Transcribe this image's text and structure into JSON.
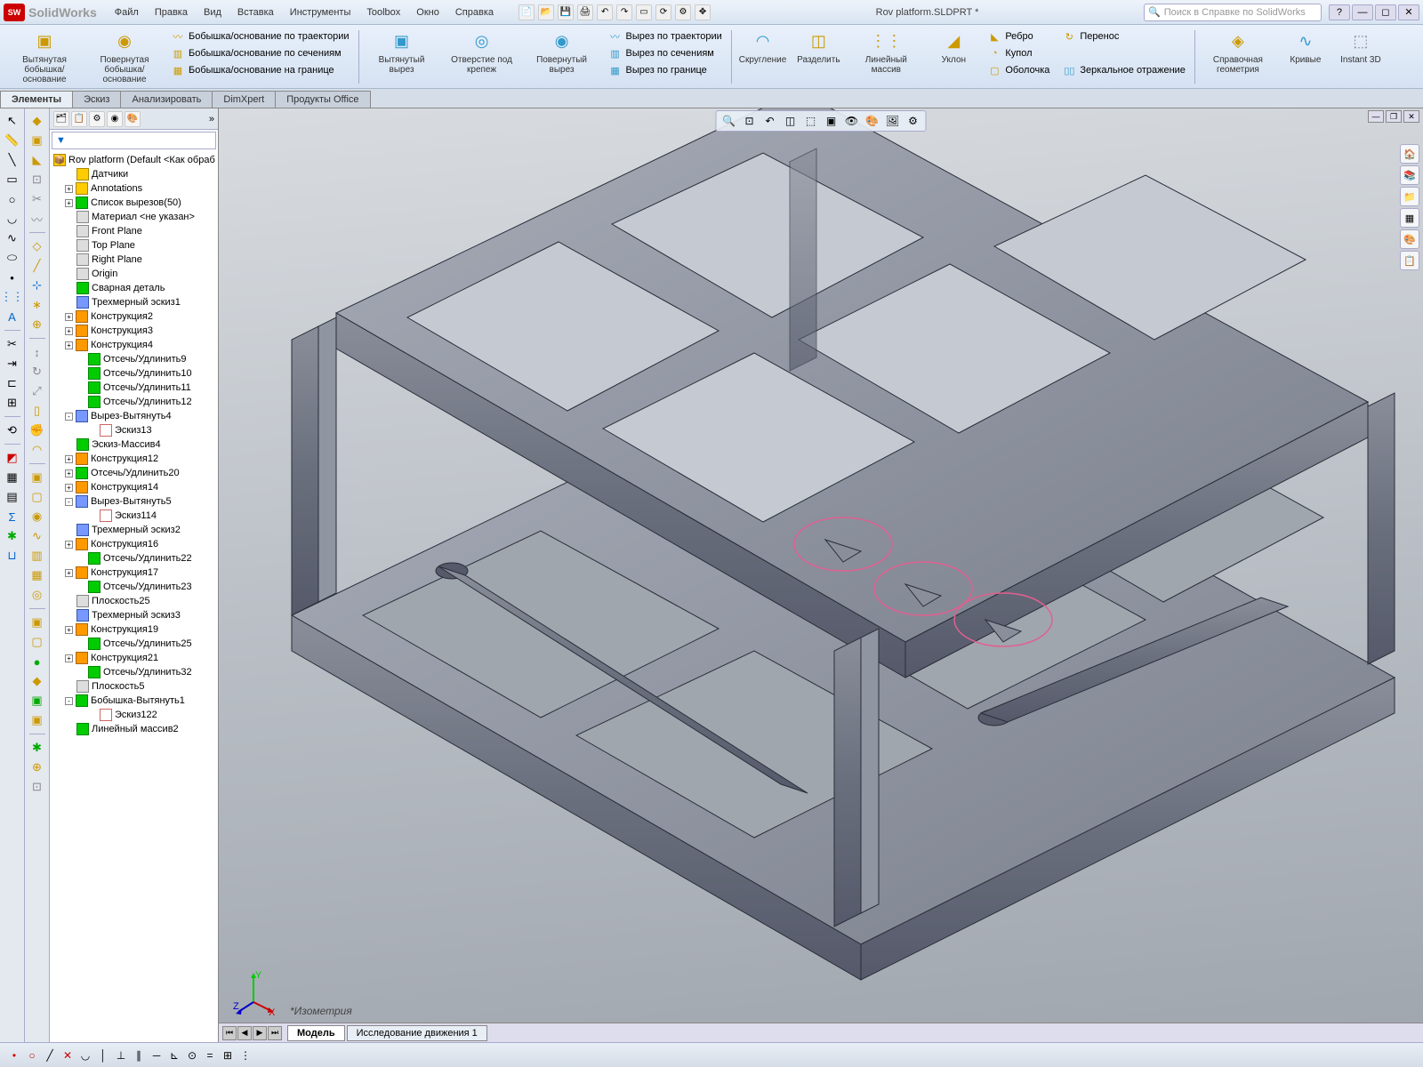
{
  "app": {
    "logo": "SW",
    "title": "SolidWorks"
  },
  "menu": [
    "Файл",
    "Правка",
    "Вид",
    "Вставка",
    "Инструменты",
    "Toolbox",
    "Окно",
    "Справка"
  ],
  "document_title": "Rov platform.SLDPRT *",
  "search_placeholder": "Поиск в Справке по SolidWorks",
  "ribbon": {
    "big": [
      {
        "label": "Вытянутая\nбобышка/основание"
      },
      {
        "label": "Повернутая\nбобышка/основание"
      }
    ],
    "boss_small": [
      "Бобышка/основание по траектории",
      "Бобышка/основание по сечениям",
      "Бобышка/основание на границе"
    ],
    "cut_big": [
      {
        "label": "Вытянутый\nвырез"
      },
      {
        "label": "Отверстие\nпод\nкрепеж"
      },
      {
        "label": "Повернутый\nвырез"
      }
    ],
    "cut_small": [
      "Вырез по траектории",
      "Вырез по сечениям",
      "Вырез по границе"
    ],
    "feat_big": [
      {
        "label": "Скругление"
      },
      {
        "label": "Разделить"
      },
      {
        "label": "Линейный\nмассив"
      },
      {
        "label": "Уклон"
      }
    ],
    "feat_small": [
      [
        "Ребро",
        "Купол",
        "Оболочка"
      ],
      [
        "Перенос",
        "",
        "Зеркальное отражение"
      ]
    ],
    "ref": [
      {
        "label": "Справочная\nгеометрия"
      },
      {
        "label": "Кривые"
      },
      {
        "label": "Instant\n3D"
      }
    ]
  },
  "tabs": [
    "Элементы",
    "Эскиз",
    "Анализировать",
    "DimXpert",
    "Продукты Office"
  ],
  "active_tab": 0,
  "tree": {
    "root": "Rov platform  (Default <Как обраб",
    "nodes": [
      {
        "l": 1,
        "exp": "",
        "ic": "y",
        "t": "Датчики"
      },
      {
        "l": 1,
        "exp": "+",
        "ic": "y",
        "t": "Annotations"
      },
      {
        "l": 1,
        "exp": "+",
        "ic": "g",
        "t": "Список вырезов(50)"
      },
      {
        "l": 1,
        "exp": "",
        "ic": "gr",
        "t": "Материал <не указан>"
      },
      {
        "l": 1,
        "exp": "",
        "ic": "gr",
        "t": "Front Plane"
      },
      {
        "l": 1,
        "exp": "",
        "ic": "gr",
        "t": "Top Plane"
      },
      {
        "l": 1,
        "exp": "",
        "ic": "gr",
        "t": "Right Plane"
      },
      {
        "l": 1,
        "exp": "",
        "ic": "gr",
        "t": "Origin"
      },
      {
        "l": 1,
        "exp": "",
        "ic": "g",
        "t": "Сварная деталь"
      },
      {
        "l": 1,
        "exp": "",
        "ic": "b",
        "t": "Трехмерный эскиз1"
      },
      {
        "l": 1,
        "exp": "+",
        "ic": "o",
        "t": "Конструкция2"
      },
      {
        "l": 1,
        "exp": "+",
        "ic": "o",
        "t": "Конструкция3"
      },
      {
        "l": 1,
        "exp": "+",
        "ic": "o",
        "t": "Конструкция4"
      },
      {
        "l": 2,
        "exp": "",
        "ic": "g",
        "t": "Отсечь/Удлинить9"
      },
      {
        "l": 2,
        "exp": "",
        "ic": "g",
        "t": "Отсечь/Удлинить10"
      },
      {
        "l": 2,
        "exp": "",
        "ic": "g",
        "t": "Отсечь/Удлинить11"
      },
      {
        "l": 2,
        "exp": "",
        "ic": "g",
        "t": "Отсечь/Удлинить12"
      },
      {
        "l": 1,
        "exp": "-",
        "ic": "b",
        "t": "Вырез-Вытянуть4"
      },
      {
        "l": 3,
        "exp": "",
        "ic": "sk",
        "t": "Эскиз13"
      },
      {
        "l": 1,
        "exp": "",
        "ic": "g",
        "t": "Эскиз-Массив4"
      },
      {
        "l": 1,
        "exp": "+",
        "ic": "o",
        "t": "Конструкция12"
      },
      {
        "l": 1,
        "exp": "+",
        "ic": "g",
        "t": "Отсечь/Удлинить20"
      },
      {
        "l": 1,
        "exp": "+",
        "ic": "o",
        "t": "Конструкция14"
      },
      {
        "l": 1,
        "exp": "-",
        "ic": "b",
        "t": "Вырез-Вытянуть5"
      },
      {
        "l": 3,
        "exp": "",
        "ic": "sk",
        "t": "Эскиз114"
      },
      {
        "l": 1,
        "exp": "",
        "ic": "b",
        "t": "Трехмерный эскиз2"
      },
      {
        "l": 1,
        "exp": "+",
        "ic": "o",
        "t": "Конструкция16"
      },
      {
        "l": 2,
        "exp": "",
        "ic": "g",
        "t": "Отсечь/Удлинить22"
      },
      {
        "l": 1,
        "exp": "+",
        "ic": "o",
        "t": "Конструкция17"
      },
      {
        "l": 2,
        "exp": "",
        "ic": "g",
        "t": "Отсечь/Удлинить23"
      },
      {
        "l": 1,
        "exp": "",
        "ic": "gr",
        "t": "Плоскость25"
      },
      {
        "l": 1,
        "exp": "",
        "ic": "b",
        "t": "Трехмерный эскиз3"
      },
      {
        "l": 1,
        "exp": "+",
        "ic": "o",
        "t": "Конструкция19"
      },
      {
        "l": 2,
        "exp": "",
        "ic": "g",
        "t": "Отсечь/Удлинить25"
      },
      {
        "l": 1,
        "exp": "+",
        "ic": "o",
        "t": "Конструкция21"
      },
      {
        "l": 2,
        "exp": "",
        "ic": "g",
        "t": "Отсечь/Удлинить32"
      },
      {
        "l": 1,
        "exp": "",
        "ic": "gr",
        "t": "Плоскость5"
      },
      {
        "l": 1,
        "exp": "-",
        "ic": "g",
        "t": "Бобышка-Вытянуть1"
      },
      {
        "l": 3,
        "exp": "",
        "ic": "sk",
        "t": "Эскиз122"
      },
      {
        "l": 1,
        "exp": "",
        "ic": "g",
        "t": "Линейный массив2"
      }
    ]
  },
  "triad": {
    "x": "X",
    "y": "Y",
    "z": "Z"
  },
  "view_label": "*Изометрия",
  "bottom_tabs": [
    "Модель",
    "Исследование движения 1"
  ],
  "active_bottom": 0
}
